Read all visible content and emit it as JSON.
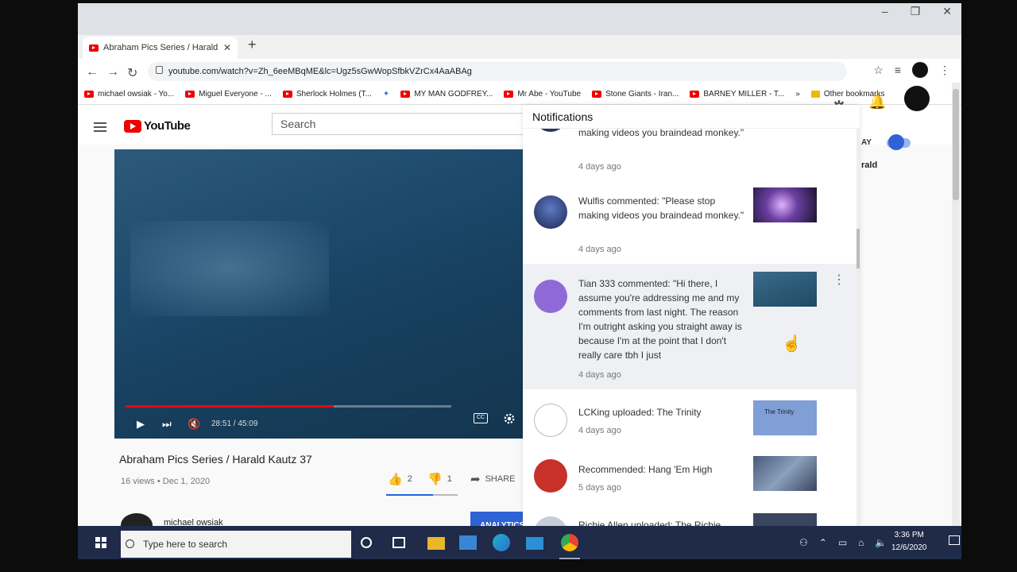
{
  "browser": {
    "tab_title": "Abraham Pics Series / Harald Kaut",
    "new_tab": "+",
    "url": "youtube.com/watch?v=Zh_6eeMBqME&lc=Ugz5sGwWopSfbkVZrCx4AaABAg",
    "bookmarks": [
      "michael owsiak - Yo...",
      "Miguel Everyone - ...",
      "Sherlock Holmes (T...",
      "MY MAN GODFREY...",
      "Mr Abe - YouTube",
      "Stone Giants - Iran...",
      "BARNEY MILLER - T..."
    ],
    "bookmarks_overflow": "»",
    "other_bookmarks": "Other bookmarks"
  },
  "youtube": {
    "logo": "YouTube",
    "search_placeholder": "Search",
    "autoplay_label": "AY",
    "upnext_partial": "rald"
  },
  "video": {
    "title": "Abraham Pics Series / Harald Kautz 37",
    "meta": "16 views • Dec 1, 2020",
    "timecode": "28:51 / 45:09",
    "progress": 0.64,
    "likes": "2",
    "dislikes": "1",
    "share": "SHARE",
    "like_ratio": 0.66,
    "channel": "michael owsiak",
    "analytics": "ANALYTICS"
  },
  "notifications": {
    "title": "Notifications",
    "items": [
      {
        "text": "making videos you braindead monkey.\"",
        "time": "4 days ago"
      },
      {
        "text": "Wulfis commented: \"Please stop making videos you braindead monkey.\"",
        "time": "4 days ago"
      },
      {
        "text": "Tian 333 commented: \"Hi there, I assume you're addressing me and my comments from last night. The reason I'm outright asking you straight away is because I'm at the point that I don't really care tbh I just",
        "time": "4 days ago"
      },
      {
        "text": "LCKing uploaded: The Trinity",
        "time": "4 days ago"
      },
      {
        "text": "Recommended: Hang 'Em High",
        "time": "5 days ago"
      },
      {
        "text": "Richie Allen uploaded: The Richie",
        "time": ""
      }
    ],
    "trinity_thumb": "The Trinity"
  },
  "taskbar": {
    "search_placeholder": "Type here to search",
    "time": "3:36 PM",
    "date": "12/6/2020"
  },
  "colors": {
    "accent": "#2e62d5",
    "youtube_red": "#ee0000",
    "taskbar": "#1f2b48"
  }
}
